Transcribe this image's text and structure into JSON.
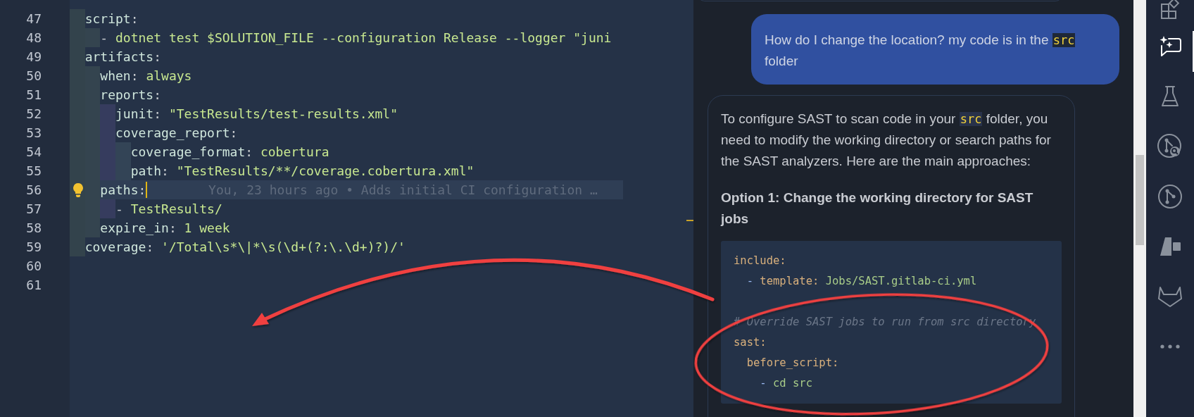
{
  "editor": {
    "lines": [
      {
        "number": "47",
        "tokens": [
          {
            "kind": "key",
            "text": "  script"
          },
          {
            "kind": "punct",
            "text": ":"
          }
        ]
      },
      {
        "number": "48",
        "tokens": [
          {
            "kind": "punct",
            "text": "    - "
          },
          {
            "kind": "value",
            "text": "dotnet test $SOLUTION_FILE --configuration Release --logger \"juni"
          }
        ]
      },
      {
        "number": "49",
        "tokens": [
          {
            "kind": "key",
            "text": "  artifacts"
          },
          {
            "kind": "punct",
            "text": ":"
          }
        ]
      },
      {
        "number": "50",
        "tokens": [
          {
            "kind": "key",
            "text": "    when"
          },
          {
            "kind": "punct",
            "text": ": "
          },
          {
            "kind": "value",
            "text": "always"
          }
        ]
      },
      {
        "number": "51",
        "tokens": [
          {
            "kind": "key",
            "text": "    reports"
          },
          {
            "kind": "punct",
            "text": ":"
          }
        ]
      },
      {
        "number": "52",
        "tokens": [
          {
            "kind": "key",
            "text": "      junit"
          },
          {
            "kind": "punct",
            "text": ": "
          },
          {
            "kind": "value",
            "text": "\"TestResults/test-results.xml\""
          }
        ]
      },
      {
        "number": "53",
        "tokens": [
          {
            "kind": "key",
            "text": "      coverage_report"
          },
          {
            "kind": "punct",
            "text": ":"
          }
        ]
      },
      {
        "number": "54",
        "tokens": [
          {
            "kind": "key",
            "text": "        coverage_format"
          },
          {
            "kind": "punct",
            "text": ": "
          },
          {
            "kind": "value",
            "text": "cobertura"
          }
        ]
      },
      {
        "number": "55",
        "tokens": [
          {
            "kind": "key",
            "text": "        path"
          },
          {
            "kind": "punct",
            "text": ": "
          },
          {
            "kind": "value",
            "text": "\"TestResults/**/coverage.cobertura.xml\""
          }
        ]
      },
      {
        "number": "56",
        "current": true,
        "lightbulb": true,
        "blame": "You, 23 hours ago • Adds initial CI configuration …",
        "tokens": [
          {
            "kind": "key",
            "text": "    paths"
          },
          {
            "kind": "punct",
            "text": ":"
          }
        ]
      },
      {
        "number": "57",
        "tokens": [
          {
            "kind": "punct",
            "text": "      - "
          },
          {
            "kind": "value",
            "text": "TestResults/"
          }
        ]
      },
      {
        "number": "58",
        "tokens": [
          {
            "kind": "key",
            "text": "    expire_in"
          },
          {
            "kind": "punct",
            "text": ": "
          },
          {
            "kind": "value",
            "text": "1 week"
          }
        ]
      },
      {
        "number": "59",
        "tokens": [
          {
            "kind": "key",
            "text": "  coverage"
          },
          {
            "kind": "punct",
            "text": ": "
          },
          {
            "kind": "value",
            "text": "'/Total\\s*\\|*\\s(\\d+(?:\\.\\d+)?)/'"
          }
        ]
      },
      {
        "number": "60"
      },
      {
        "number": "61"
      }
    ]
  },
  "chat": {
    "messages": [
      {
        "kind": "user",
        "parts": [
          {
            "kind": "text",
            "text": "How do I change the location? my code is in the "
          },
          {
            "kind": "code",
            "text": "src"
          },
          {
            "kind": "text",
            "text": " folder"
          }
        ]
      },
      {
        "kind": "assistant",
        "parts": [
          {
            "kind": "text",
            "text": "To configure SAST to scan code in your "
          },
          {
            "kind": "code",
            "text": "src"
          },
          {
            "kind": "text",
            "text": " folder, you need to modify the working directory or search paths for the SAST analyzers. Here are the main approaches:"
          }
        ],
        "heading": "Option 1: Change the working directory for SAST jobs",
        "code_block": [
          {
            "tokens": [
              {
                "kind": "key",
                "text": "include"
              },
              {
                "kind": "key",
                "text": ":"
              }
            ]
          },
          {
            "tokens": [
              {
                "kind": "dash",
                "text": "  - "
              },
              {
                "kind": "key",
                "text": "template: "
              },
              {
                "kind": "value",
                "text": "Jobs/SAST.gitlab-ci.yml"
              }
            ]
          },
          {
            "kind": "blank"
          },
          {
            "tokens": [
              {
                "kind": "comment",
                "text": "# Override SAST jobs to run from src directory"
              }
            ]
          },
          {
            "tokens": [
              {
                "kind": "key",
                "text": "sast:"
              }
            ]
          },
          {
            "tokens": [
              {
                "kind": "key",
                "text": "  before_script:"
              }
            ]
          },
          {
            "tokens": [
              {
                "kind": "dash",
                "text": "    - "
              },
              {
                "kind": "value",
                "text": "cd src"
              }
            ]
          }
        ]
      }
    ]
  },
  "activity_bar": [
    {
      "kind": "extensions",
      "selected": false
    },
    {
      "kind": "chat",
      "selected": true
    },
    {
      "kind": "flask",
      "selected": false
    },
    {
      "kind": "merge-search",
      "selected": false
    },
    {
      "kind": "merge",
      "selected": false
    },
    {
      "kind": "agent",
      "selected": false
    },
    {
      "kind": "gitlab",
      "selected": false
    },
    {
      "kind": "more",
      "selected": false
    }
  ]
}
